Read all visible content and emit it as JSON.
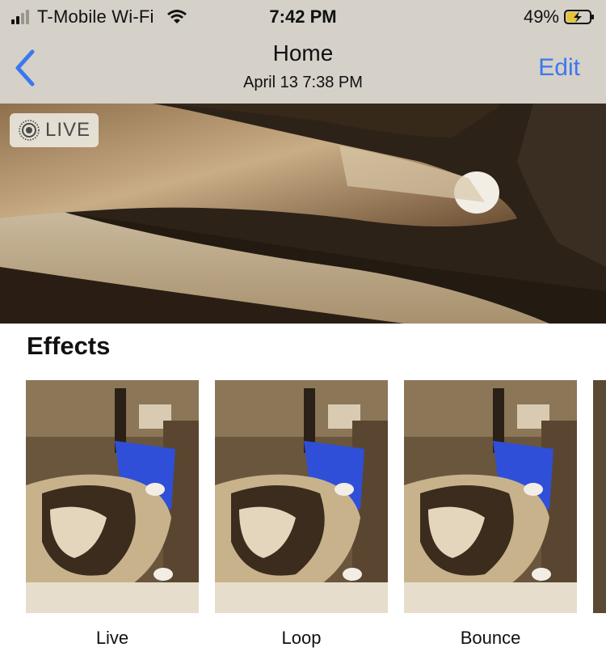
{
  "status_bar": {
    "carrier": "T-Mobile Wi-Fi",
    "time": "7:42 PM",
    "battery_percent": "49%",
    "signal_bars_active": 2,
    "signal_bars_total": 4,
    "battery_level": 0.49,
    "battery_charging": true
  },
  "nav": {
    "title": "Home",
    "subtitle": "April 13  7:38 PM",
    "edit_label": "Edit",
    "back_icon": "chevron-left-icon",
    "accent_color": "#3a78f2"
  },
  "photo": {
    "badge_label": "LIVE",
    "badge_icon": "live-photo-icon"
  },
  "effects": {
    "title": "Effects",
    "items": [
      {
        "label": "Live",
        "selected": true
      },
      {
        "label": "Loop",
        "selected": false
      },
      {
        "label": "Bounce",
        "selected": false
      }
    ],
    "selection_color": "#3a6ff0"
  }
}
